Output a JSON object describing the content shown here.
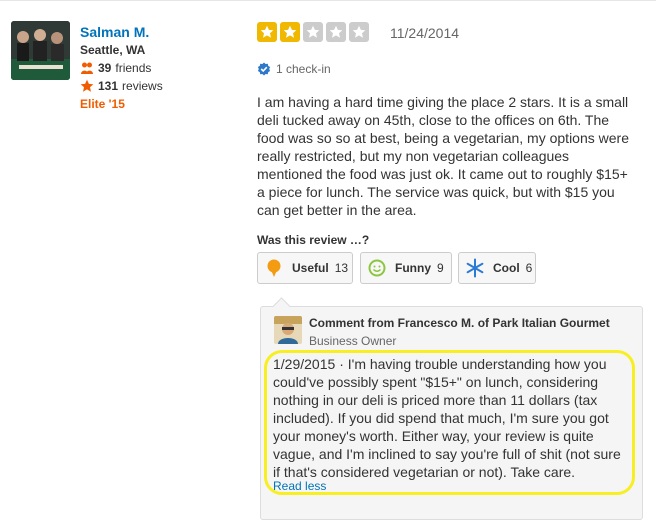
{
  "user": {
    "name": "Salman M.",
    "location": "Seattle, WA",
    "friends_count": "39",
    "friends_label": "friends",
    "reviews_count": "131",
    "reviews_label": "reviews",
    "elite": "Elite '15"
  },
  "review": {
    "rating": 2,
    "rating_max": 5,
    "date": "11/24/2014",
    "checkin": "1 check-in",
    "text": "I am having a hard time giving the place 2 stars. It is a small deli tucked away on 45th, close to the offices on 6th. The food was so so at best, being a vegetarian, my options were really restricted, but my non vegetarian colleagues mentioned the food was just ok. It came out to roughly $15+ a piece for lunch. The service was quick, but with $15 you can get better in the area."
  },
  "votes": {
    "prompt": "Was this review …?",
    "useful": {
      "label": "Useful",
      "count": "13"
    },
    "funny": {
      "label": "Funny",
      "count": "9"
    },
    "cool": {
      "label": "Cool",
      "count": "6"
    }
  },
  "owner_comment": {
    "title": "Comment from Francesco M. of Park Italian Gourmet",
    "role": "Business Owner",
    "date": "1/29/2015",
    "separator": "·",
    "text": "I'm having trouble understanding how you could've possibly spent \"$15+\" on lunch,  considering nothing in our deli is priced more than 11 dollars (tax included). If you did spend that much, I'm sure you got your money's worth. Either way, your review is quite vague, and I'm inclined to say you're full of shit (not sure if that's considered vegetarian or not). Take care.",
    "read_less": "Read less"
  },
  "colors": {
    "link_blue": "#0073bb",
    "star_on": "#f0b800",
    "star_off": "#cccccc",
    "elite_orange": "#f15c00",
    "highlight_yellow": "#f7ef21"
  },
  "icons": {
    "friends": "friends-icon",
    "reviews": "star-icon",
    "checkin": "check-badge-icon",
    "useful": "lightbulb-icon",
    "funny": "smiley-icon",
    "cool": "snowflake-icon"
  }
}
